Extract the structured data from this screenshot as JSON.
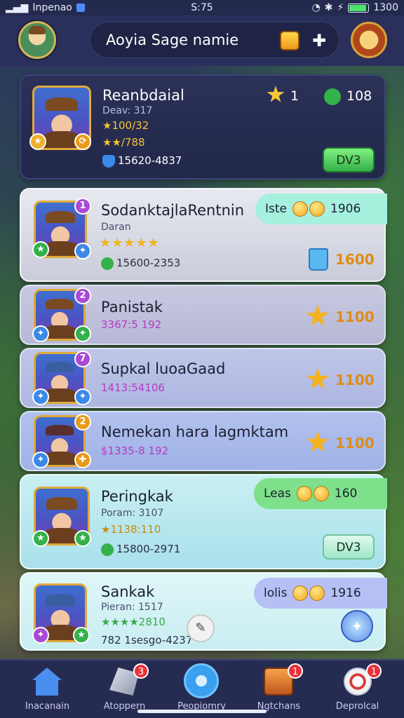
{
  "status_bar": {
    "carrier": "Inpenao",
    "time": "S:75",
    "battery": "1300"
  },
  "header": {
    "title": "Aoyia Sage namie"
  },
  "top_card": {
    "name": "Reanbdaial",
    "sub": "Deav: 317",
    "stat1": "★100/32",
    "stat2": "★★/788",
    "id": "15620-4837",
    "gem_count": "1",
    "coin_count": "108",
    "button": "DV3"
  },
  "rows": [
    {
      "name": "SodanktajlaRentnin",
      "sub": "Daran",
      "stars": "★★★★★",
      "id": "15600-2353",
      "reward_label": "Iste",
      "reward_value": "1906",
      "value": "1600",
      "badge_top": "1"
    },
    {
      "name": "Panistak",
      "meta": "3367:5 192",
      "value": "1100",
      "badge_top": "2"
    },
    {
      "name": "Supkal luoaGaad",
      "meta": "1413:54106",
      "value": "1100",
      "badge_top": "7"
    },
    {
      "name": "Nemekan hara lagmktam",
      "meta": "$1335-8 192",
      "value": "1100",
      "badge_top": "2"
    },
    {
      "name": "Peringkak",
      "sub": "Poram: 3107",
      "stat": "★1138:110",
      "id": "15800-2971",
      "reward_label": "Leas",
      "reward_value": "160",
      "button": "DV3"
    },
    {
      "name": "Sankak",
      "sub": "Pieran: 1517",
      "stat": "★★★★2810",
      "id": "782 1sesgo-4237",
      "reward_label": "lolis",
      "reward_value": "1916"
    }
  ],
  "bottom_nav": [
    {
      "label": "Inacanain",
      "badge": ""
    },
    {
      "label": "Atoppern",
      "badge": "3"
    },
    {
      "label": "Peopiomry",
      "badge": ""
    },
    {
      "label": "Ngtchans",
      "badge": "1"
    },
    {
      "label": "Deprolcal",
      "badge": "1"
    }
  ],
  "colors": {
    "accent_green": "#33b14a",
    "value_orange": "#e08c14",
    "nav_bg": "#262b52"
  }
}
